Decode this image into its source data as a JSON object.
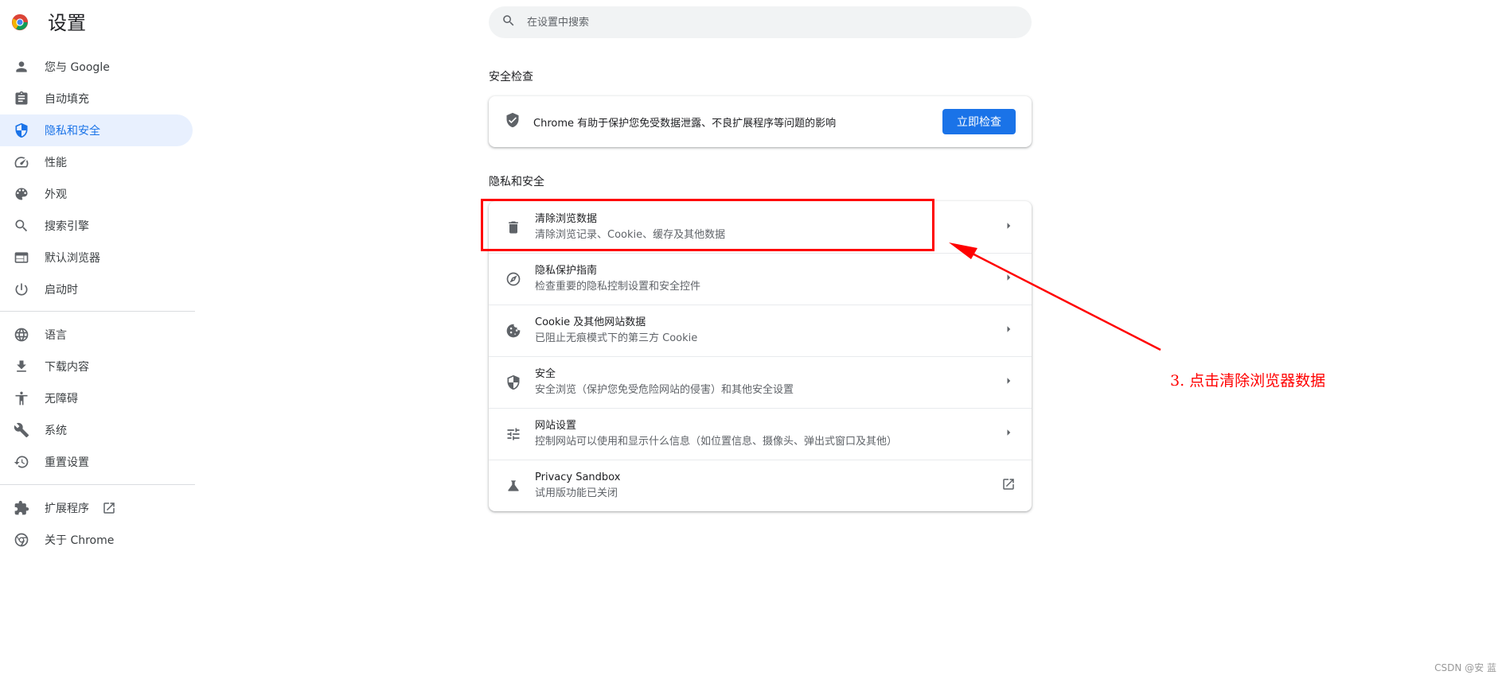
{
  "app": {
    "title": "设置"
  },
  "search": {
    "placeholder": "在设置中搜索"
  },
  "sidebar": {
    "items": [
      {
        "label": "您与 Google",
        "icon": "person-icon"
      },
      {
        "label": "自动填充",
        "icon": "clipboard-icon"
      },
      {
        "label": "隐私和安全",
        "icon": "shield-icon",
        "active": true
      },
      {
        "label": "性能",
        "icon": "speedometer-icon"
      },
      {
        "label": "外观",
        "icon": "palette-icon"
      },
      {
        "label": "搜索引擎",
        "icon": "search-icon"
      },
      {
        "label": "默认浏览器",
        "icon": "browser-icon"
      },
      {
        "label": "启动时",
        "icon": "power-icon"
      },
      {
        "label": "语言",
        "icon": "globe-icon"
      },
      {
        "label": "下载内容",
        "icon": "download-icon"
      },
      {
        "label": "无障碍",
        "icon": "accessibility-icon"
      },
      {
        "label": "系统",
        "icon": "wrench-icon"
      },
      {
        "label": "重置设置",
        "icon": "history-icon"
      },
      {
        "label": "扩展程序",
        "icon": "puzzle-icon"
      },
      {
        "label": "关于 Chrome",
        "icon": "chrome-icon"
      }
    ]
  },
  "safety_check": {
    "heading": "安全检查",
    "text": "Chrome 有助于保护您免受数据泄露、不良扩展程序等问题的影响",
    "button": "立即检查"
  },
  "privacy": {
    "heading": "隐私和安全",
    "rows": [
      {
        "title": "清除浏览数据",
        "subtitle": "清除浏览记录、Cookie、缓存及其他数据",
        "icon": "trash-icon"
      },
      {
        "title": "隐私保护指南",
        "subtitle": "检查重要的隐私控制设置和安全控件",
        "icon": "compass-icon"
      },
      {
        "title": "Cookie 及其他网站数据",
        "subtitle": "已阻止无痕模式下的第三方 Cookie",
        "icon": "cookie-icon"
      },
      {
        "title": "安全",
        "subtitle": "安全浏览（保护您免受危险网站的侵害）和其他安全设置",
        "icon": "security-shield-icon"
      },
      {
        "title": "网站设置",
        "subtitle": "控制网站可以使用和显示什么信息（如位置信息、摄像头、弹出式窗口及其他）",
        "icon": "tune-icon"
      },
      {
        "title": "Privacy Sandbox",
        "subtitle": "试用版功能已关闭",
        "icon": "flask-icon"
      }
    ]
  },
  "annotation": {
    "text": "3. 点击清除浏览器数据",
    "color": "#ff0000"
  },
  "watermark": "CSDN @安 蓝",
  "colors": {
    "accent": "#1a73e8",
    "active_bg": "#e8f0fe"
  }
}
